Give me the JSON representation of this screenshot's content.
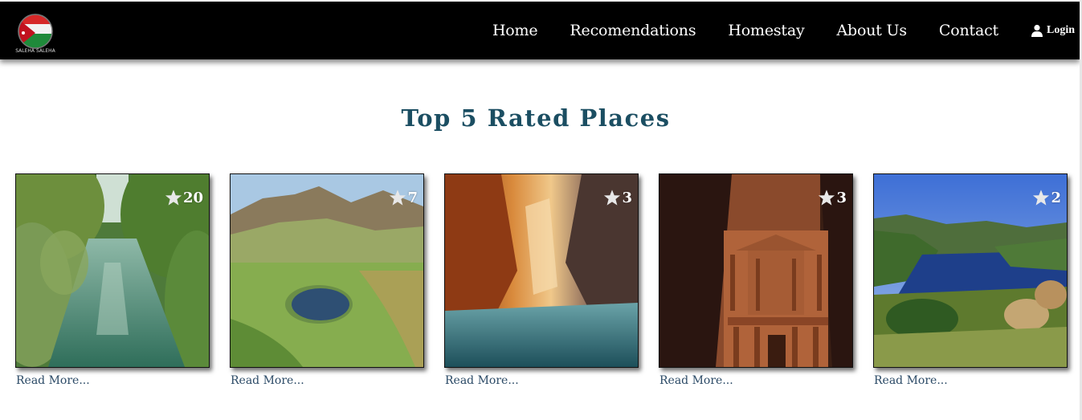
{
  "nav": {
    "logo_text": "SALEHA SALEHA",
    "links": [
      "Home",
      "Recomendations",
      "Homestay",
      "About Us",
      "Contact"
    ],
    "login_label": "Login"
  },
  "section": {
    "title": "Top 5 Rated Places"
  },
  "cards": [
    {
      "rating": "20",
      "read_more": "Read More...",
      "scene": "river"
    },
    {
      "rating": "7",
      "read_more": "Read More...",
      "scene": "mountain-lake"
    },
    {
      "rating": "3",
      "read_more": "Read More...",
      "scene": "canyon"
    },
    {
      "rating": "3",
      "read_more": "Read More...",
      "scene": "petra-treasury"
    },
    {
      "rating": "2",
      "read_more": "Read More...",
      "scene": "dam-lake"
    }
  ],
  "colors": {
    "nav_bg": "#000000",
    "title": "#1b4e62",
    "link": "#2b4a66"
  }
}
